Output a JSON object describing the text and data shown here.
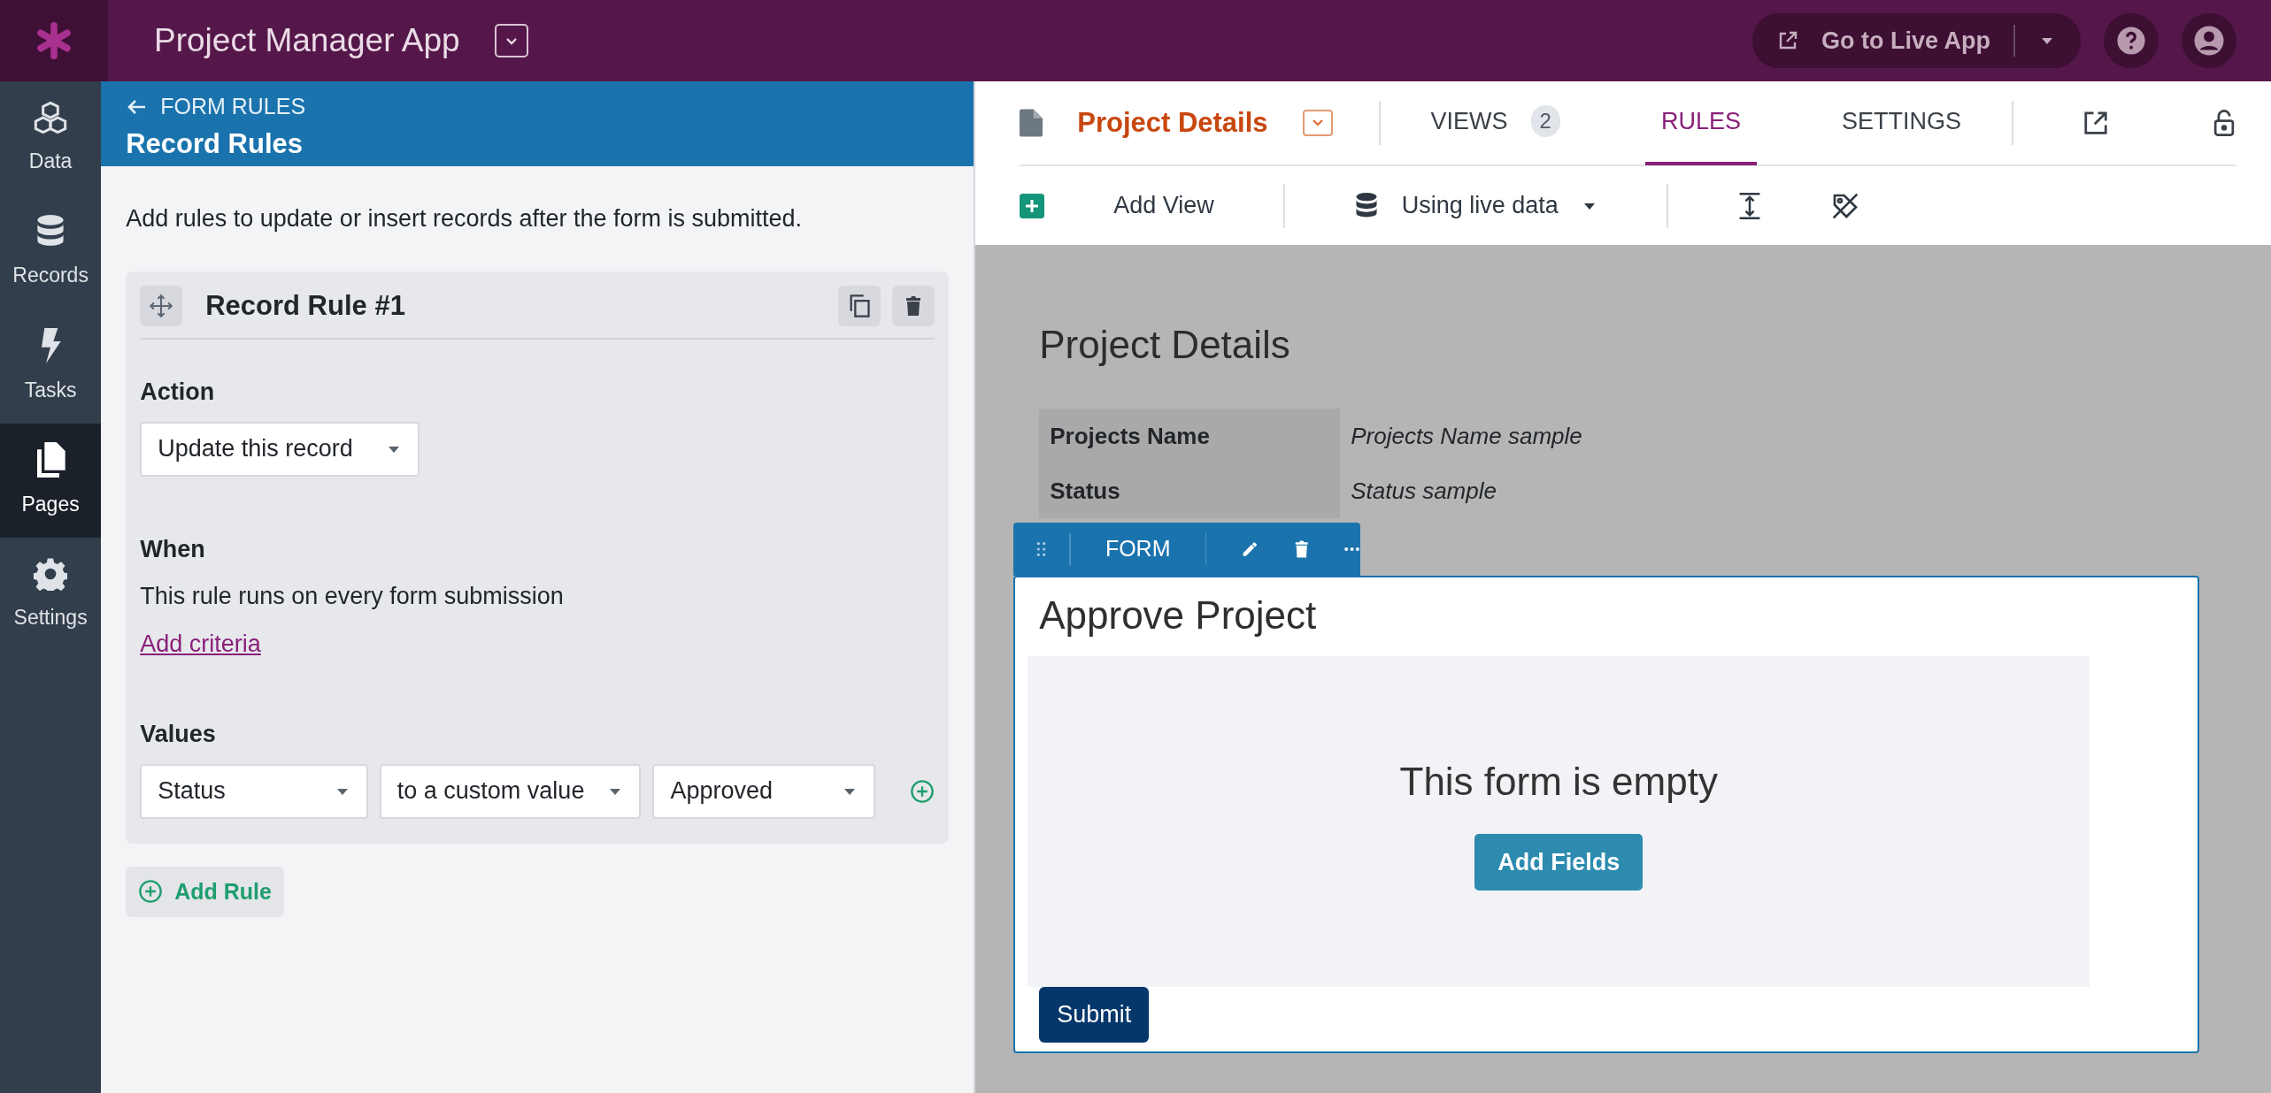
{
  "app": {
    "title": "Project Manager App",
    "live_app_button": "Go to Live App"
  },
  "sidebar": {
    "items": [
      {
        "label": "Data",
        "selected": false
      },
      {
        "label": "Records",
        "selected": false
      },
      {
        "label": "Tasks",
        "selected": false
      },
      {
        "label": "Pages",
        "selected": true
      },
      {
        "label": "Settings",
        "selected": false
      }
    ]
  },
  "panel": {
    "back_link": "FORM RULES",
    "title": "Record Rules",
    "description": "Add rules to update or insert records after the form is submitted.",
    "rules": [
      {
        "title": "Record Rule #1",
        "action_label": "Action",
        "action_value": "Update this record",
        "when_label": "When",
        "when_text": "This rule runs on every form submission",
        "criteria_link": "Add criteria",
        "values_label": "Values",
        "values": [
          {
            "field": "Status",
            "mode": "to a custom value",
            "value": "Approved"
          }
        ]
      }
    ],
    "add_rule": "Add Rule"
  },
  "page_header": {
    "title": "Project Details",
    "tabs": [
      {
        "label": "VIEWS",
        "count": "2",
        "selected": false
      },
      {
        "label": "RULES",
        "selected": true
      },
      {
        "label": "SETTINGS",
        "selected": false
      }
    ]
  },
  "toolbar": {
    "add_view": "Add View",
    "data_source": "Using live data"
  },
  "canvas": {
    "heading": "Project Details",
    "details": [
      {
        "label": "Projects Name",
        "value": "Projects Name sample"
      },
      {
        "label": "Status",
        "value": "Status sample"
      }
    ],
    "form": {
      "toolbar_label": "FORM",
      "title": "Approve Project",
      "empty_text": "This form is empty",
      "add_fields": "Add Fields",
      "submit": "Submit"
    }
  }
}
